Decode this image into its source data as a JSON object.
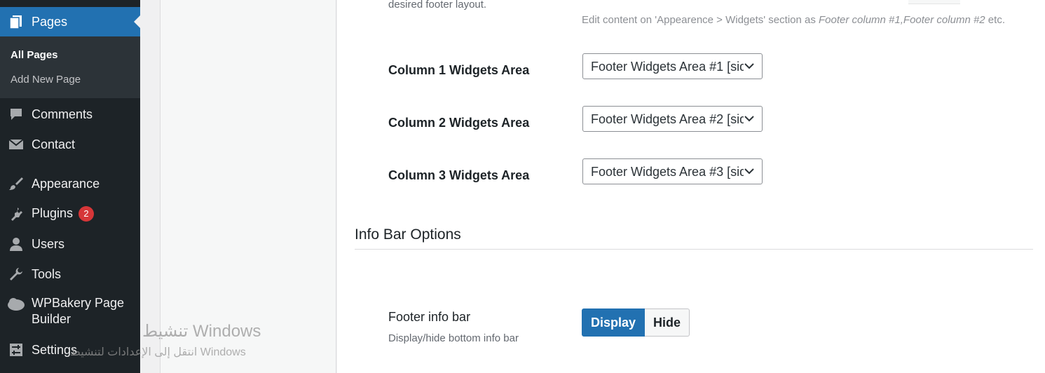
{
  "sidebar": {
    "pages_label": "Pages",
    "submenu": {
      "all_pages": "All Pages",
      "add_new": "Add New Page"
    },
    "comments": "Comments",
    "contact": "Contact",
    "appearance": "Appearance",
    "plugins": "Plugins",
    "plugins_badge": "2",
    "users": "Users",
    "tools": "Tools",
    "wpbakery_line1": "WPBakery Page",
    "wpbakery_line2": "Builder",
    "settings": "Settings"
  },
  "footer": {
    "layout_desc_tail": "desired footer layout.",
    "hint_prefix": "Edit content on 'Appearence > Widgets' section as ",
    "hint_italic1": "Footer column #1,Footer column #2",
    "hint_suffix": " etc.",
    "rows": [
      {
        "label": "Column 1 Widgets Area",
        "value": "Footer Widgets Area #1 [sid"
      },
      {
        "label": "Column 2 Widgets Area",
        "value": "Footer Widgets Area #2 [sid"
      },
      {
        "label": "Column 3 Widgets Area",
        "value": "Footer Widgets Area #3 [sid"
      }
    ]
  },
  "info_bar": {
    "section_title": "Info Bar Options",
    "footer_info_bar_label": "Footer info bar",
    "footer_info_bar_desc": "Display/hide bottom info bar",
    "display_label": "Display",
    "hide_label": "Hide",
    "selected": "Display"
  },
  "watermark": {
    "line1": "تنشيط Windows",
    "line2": "انتقل إلى الإعدادات لتنشيط Windows"
  },
  "colors": {
    "sidebar_bg": "#1d2327",
    "active_blue": "#2271b1",
    "badge_red": "#d63638"
  }
}
